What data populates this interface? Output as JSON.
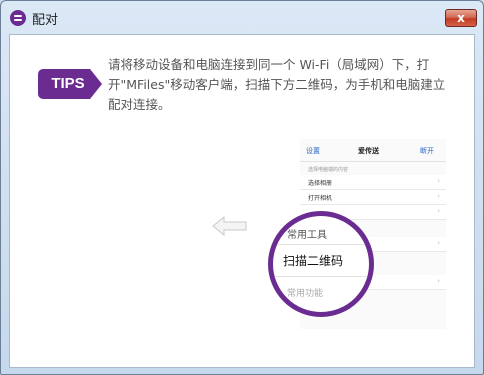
{
  "window": {
    "title": "配对",
    "close_label": "x"
  },
  "tips": {
    "badge": "TIPS",
    "text": "请将移动设备和电脑连接到同一个 Wi-Fi（局域网）下，打开\"MFiles\"移动客户端，扫描下方二维码，为手机和电脑建立配对连接。"
  },
  "phone": {
    "nav_left": "设置",
    "nav_title": "爱传送",
    "nav_right": "断开",
    "section1": "选择电脑端的内容",
    "rows": [
      {
        "label": "选择相册",
        "chevron": "›"
      },
      {
        "label": "打开相机",
        "chevron": "›"
      },
      {
        "label": "",
        "chevron": "›"
      },
      {
        "label": "",
        "chevron": "›"
      },
      {
        "label": "",
        "chevron": "›"
      }
    ],
    "section2": "常用工具"
  },
  "magnifier": {
    "common_tools": "常用工具",
    "scan_qr": "扫描二维码",
    "faded_item": "常用功能"
  },
  "colors": {
    "accent": "#6b2c91",
    "link": "#2b67c8",
    "close": "#c13c22"
  }
}
